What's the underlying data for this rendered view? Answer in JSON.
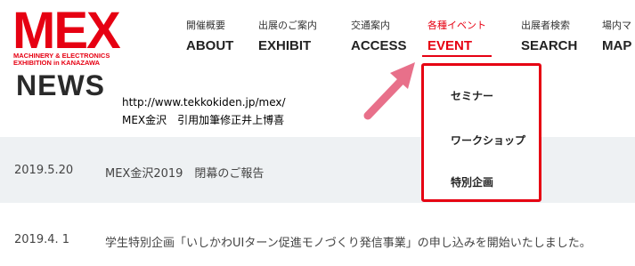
{
  "logo": {
    "mark": "MEX",
    "line1": "MACHINERY & ELECTRONICS",
    "line2": "EXHIBITION in KANAZAWA"
  },
  "nav": [
    {
      "jp": "開催概要",
      "en": "ABOUT"
    },
    {
      "jp": "出展のご案内",
      "en": "EXHIBIT"
    },
    {
      "jp": "交通案内",
      "en": "ACCESS"
    },
    {
      "jp": "各種イベント",
      "en": "EVENT"
    },
    {
      "jp": "出展者検索",
      "en": "SEARCH"
    },
    {
      "jp": "場内マ",
      "en": "MAP"
    }
  ],
  "page_title": "NEWS",
  "annotation": {
    "url": "http://www.tekkokiden.jp/mex/",
    "note": "MEX金沢　引用加筆修正井上博喜"
  },
  "news": [
    {
      "date": "2019.5.20",
      "text": "MEX金沢2019　閉幕のご報告"
    },
    {
      "date": "2019.4. 1",
      "text": "学生特別企画「いしかわUIターン促進モノづくり発信事業」の申し込みを開始いたしました。"
    }
  ],
  "dropdown": {
    "items": [
      "セミナー",
      "ワークショップ",
      "特別企画"
    ]
  },
  "colors": {
    "brand": "#e60012",
    "band": "#eef1f3",
    "arrow": "#e8708a"
  }
}
